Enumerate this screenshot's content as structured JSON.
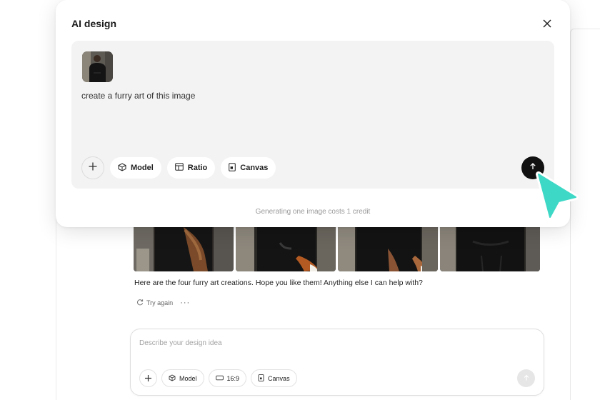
{
  "modal": {
    "title": "AI design",
    "prompt_text": "create a furry art of this image",
    "chips": {
      "model": "Model",
      "ratio": "Ratio",
      "canvas": "Canvas"
    },
    "credit_note": "Generating one image costs 1 credit"
  },
  "chat": {
    "reply": "Here are the four furry art creations. Hope you like them! Anything else I can help with?",
    "try_again": "Try again",
    "more": "···"
  },
  "prompt_box": {
    "placeholder": "Describe your design idea",
    "chips": {
      "model": "Model",
      "ratio": "16:9",
      "canvas": "Canvas"
    }
  },
  "colors": {
    "accent_cursor": "#3ed8c6",
    "send_button": "#111111"
  },
  "icons": [
    "close-icon",
    "plus-icon",
    "cube-icon",
    "ratio-icon",
    "canvas-icon",
    "arrow-up-icon",
    "refresh-icon",
    "cursor-pointer-icon"
  ]
}
